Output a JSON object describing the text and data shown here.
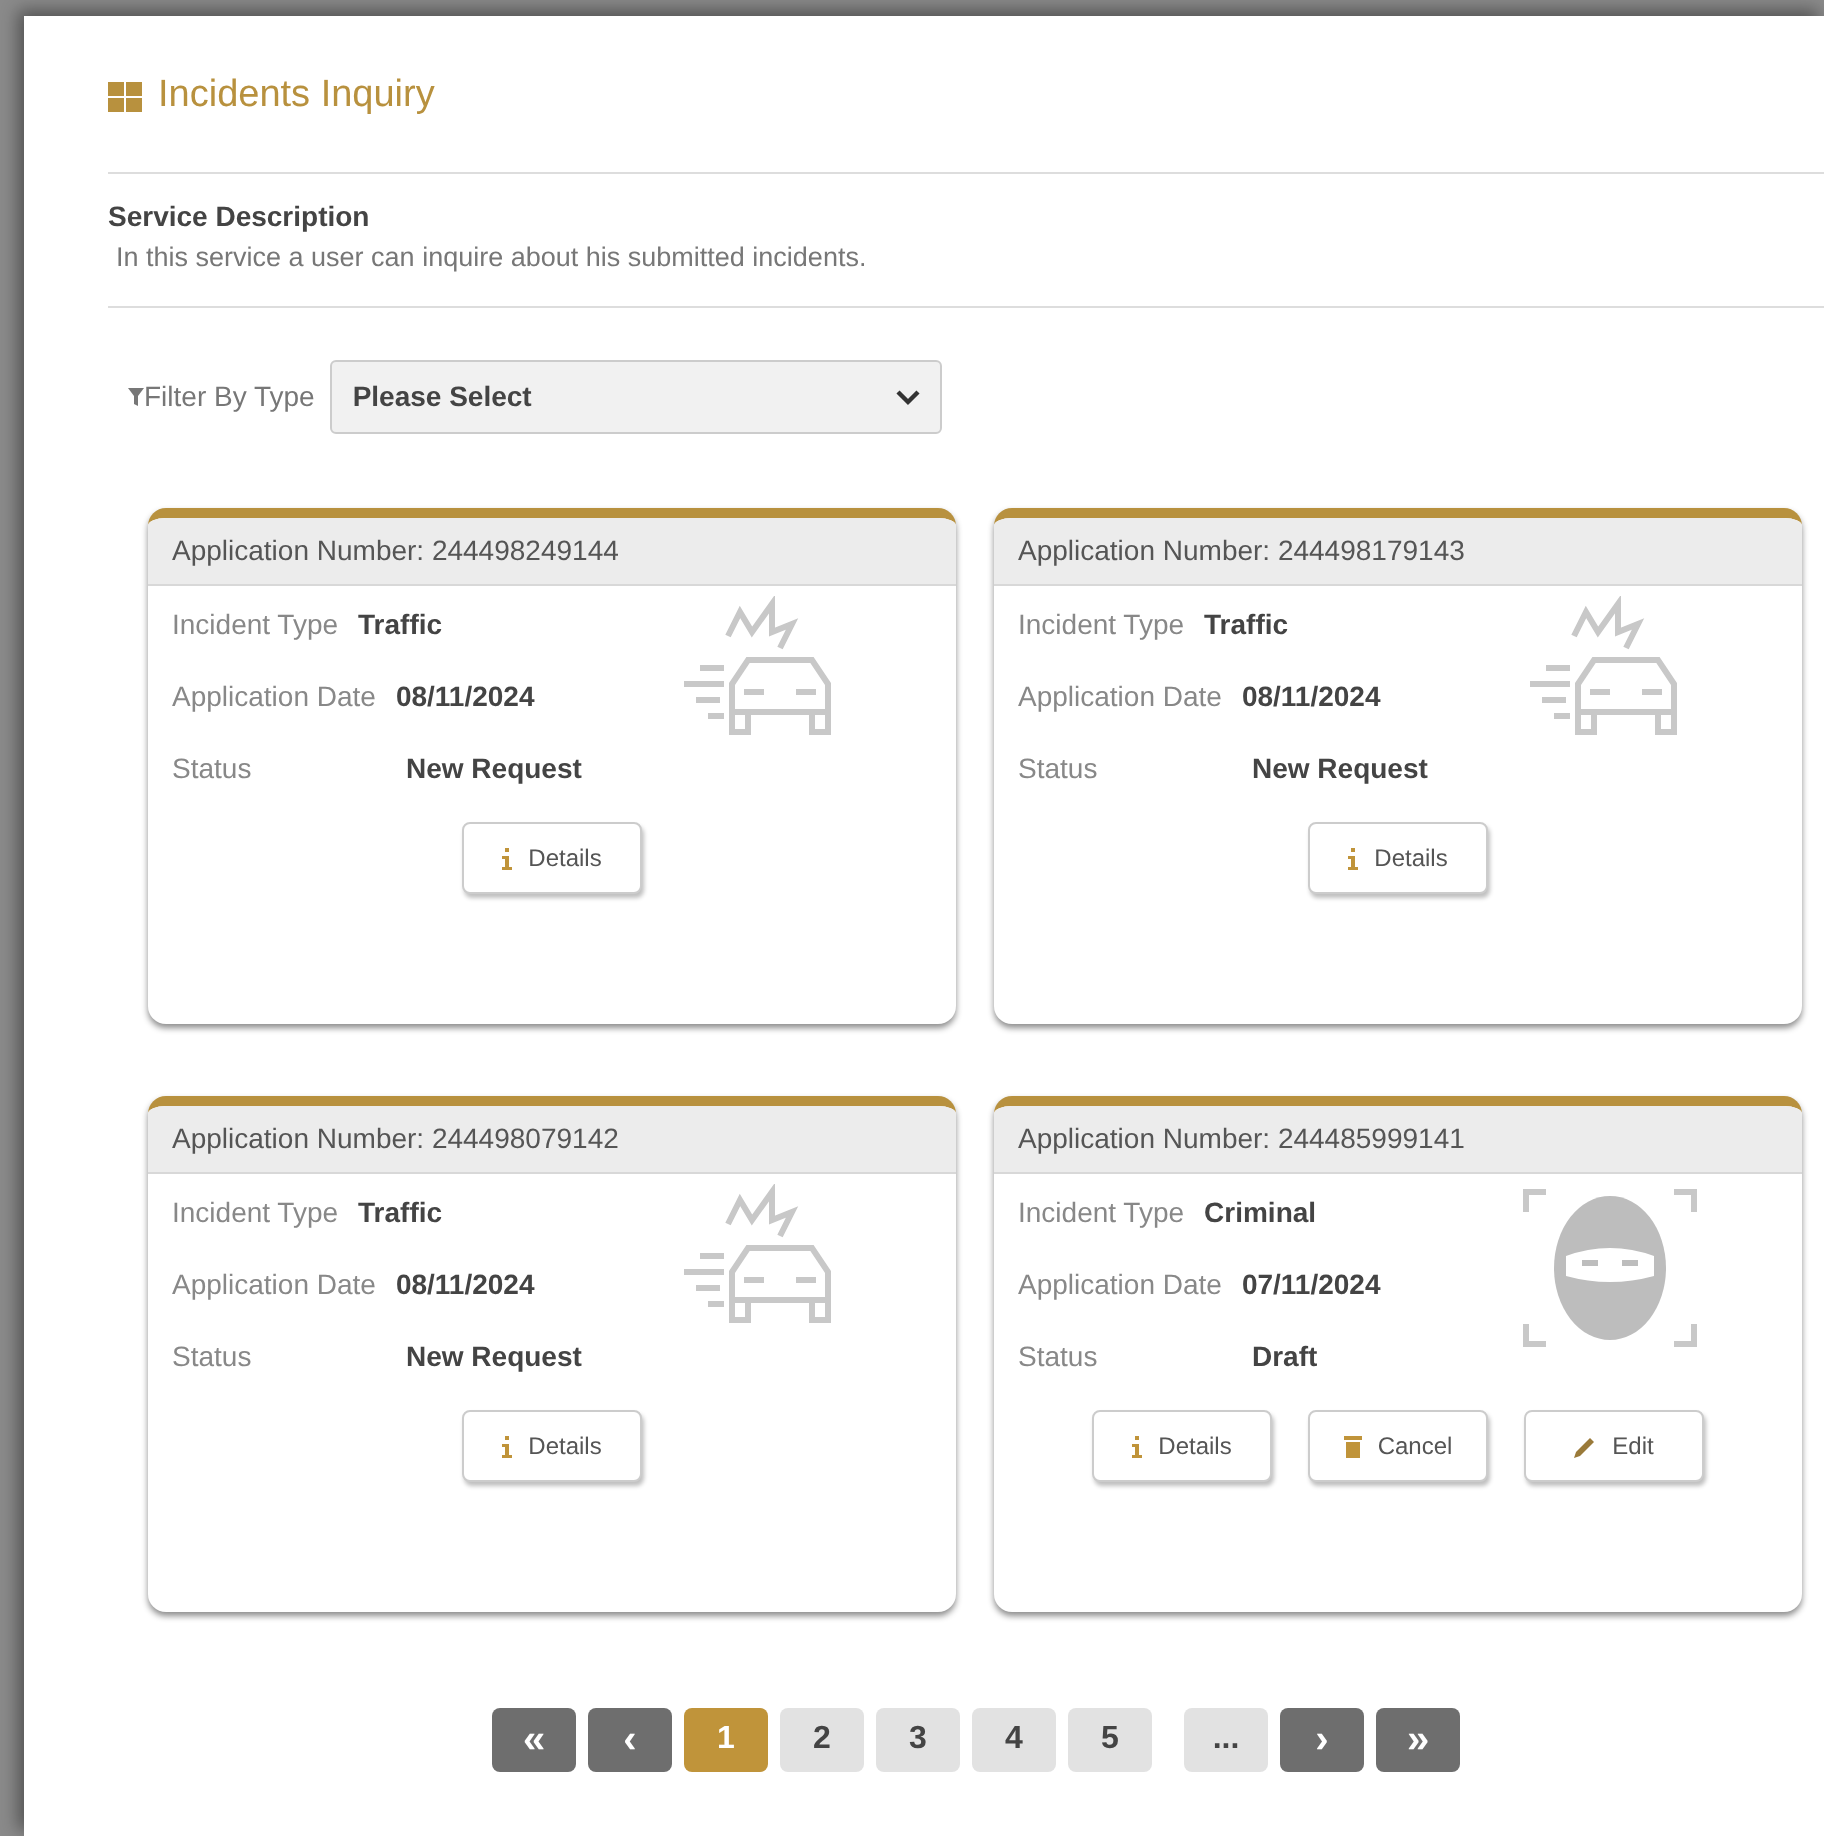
{
  "page": {
    "title": "Incidents Inquiry"
  },
  "service": {
    "heading": "Service Description",
    "text": "In this service a user can inquire about his submitted incidents."
  },
  "filter": {
    "label": "Filter By Type",
    "value": "Please Select"
  },
  "cards": [
    {
      "number_label": "Application Number: 244498249144",
      "kind": "traffic",
      "fields": [
        {
          "label": "Incident Type",
          "value": "Traffic"
        },
        {
          "label": "Application Date",
          "value": "08/11/2024"
        },
        {
          "label": "Status",
          "value": "New Request"
        }
      ],
      "buttons": [
        {
          "kind": "details",
          "label": "Details"
        }
      ]
    },
    {
      "number_label": "Application Number: 244498179143",
      "kind": "traffic",
      "fields": [
        {
          "label": "Incident Type",
          "value": "Traffic"
        },
        {
          "label": "Application Date",
          "value": "08/11/2024"
        },
        {
          "label": "Status",
          "value": "New Request"
        }
      ],
      "buttons": [
        {
          "kind": "details",
          "label": "Details"
        }
      ]
    },
    {
      "number_label": "Application Number: 244498079142",
      "kind": "traffic",
      "fields": [
        {
          "label": "Incident Type",
          "value": "Traffic"
        },
        {
          "label": "Application Date",
          "value": "08/11/2024"
        },
        {
          "label": "Status",
          "value": "New Request"
        }
      ],
      "buttons": [
        {
          "kind": "details",
          "label": "Details"
        }
      ]
    },
    {
      "number_label": "Application Number: 244485999141",
      "kind": "criminal",
      "fields": [
        {
          "label": "Incident Type",
          "value": "Criminal"
        },
        {
          "label": "Application Date",
          "value": "07/11/2024"
        },
        {
          "label": "Status",
          "value": "Draft"
        }
      ],
      "buttons": [
        {
          "kind": "details",
          "label": "Details"
        },
        {
          "kind": "cancel",
          "label": "Cancel"
        },
        {
          "kind": "edit",
          "label": "Edit"
        }
      ]
    }
  ],
  "pagination": [
    {
      "kind": "nav",
      "label": "«",
      "selected": false
    },
    {
      "kind": "nav",
      "label": "‹",
      "selected": false
    },
    {
      "kind": "page",
      "label": "1",
      "selected": true
    },
    {
      "kind": "page",
      "label": "2",
      "selected": false
    },
    {
      "kind": "page",
      "label": "3",
      "selected": false
    },
    {
      "kind": "page",
      "label": "4",
      "selected": false
    },
    {
      "kind": "page",
      "label": "5",
      "selected": false
    },
    {
      "kind": "ellipsis",
      "label": "...",
      "selected": false
    },
    {
      "kind": "nav",
      "label": "›",
      "selected": false
    },
    {
      "kind": "nav",
      "label": "»",
      "selected": false
    }
  ]
}
